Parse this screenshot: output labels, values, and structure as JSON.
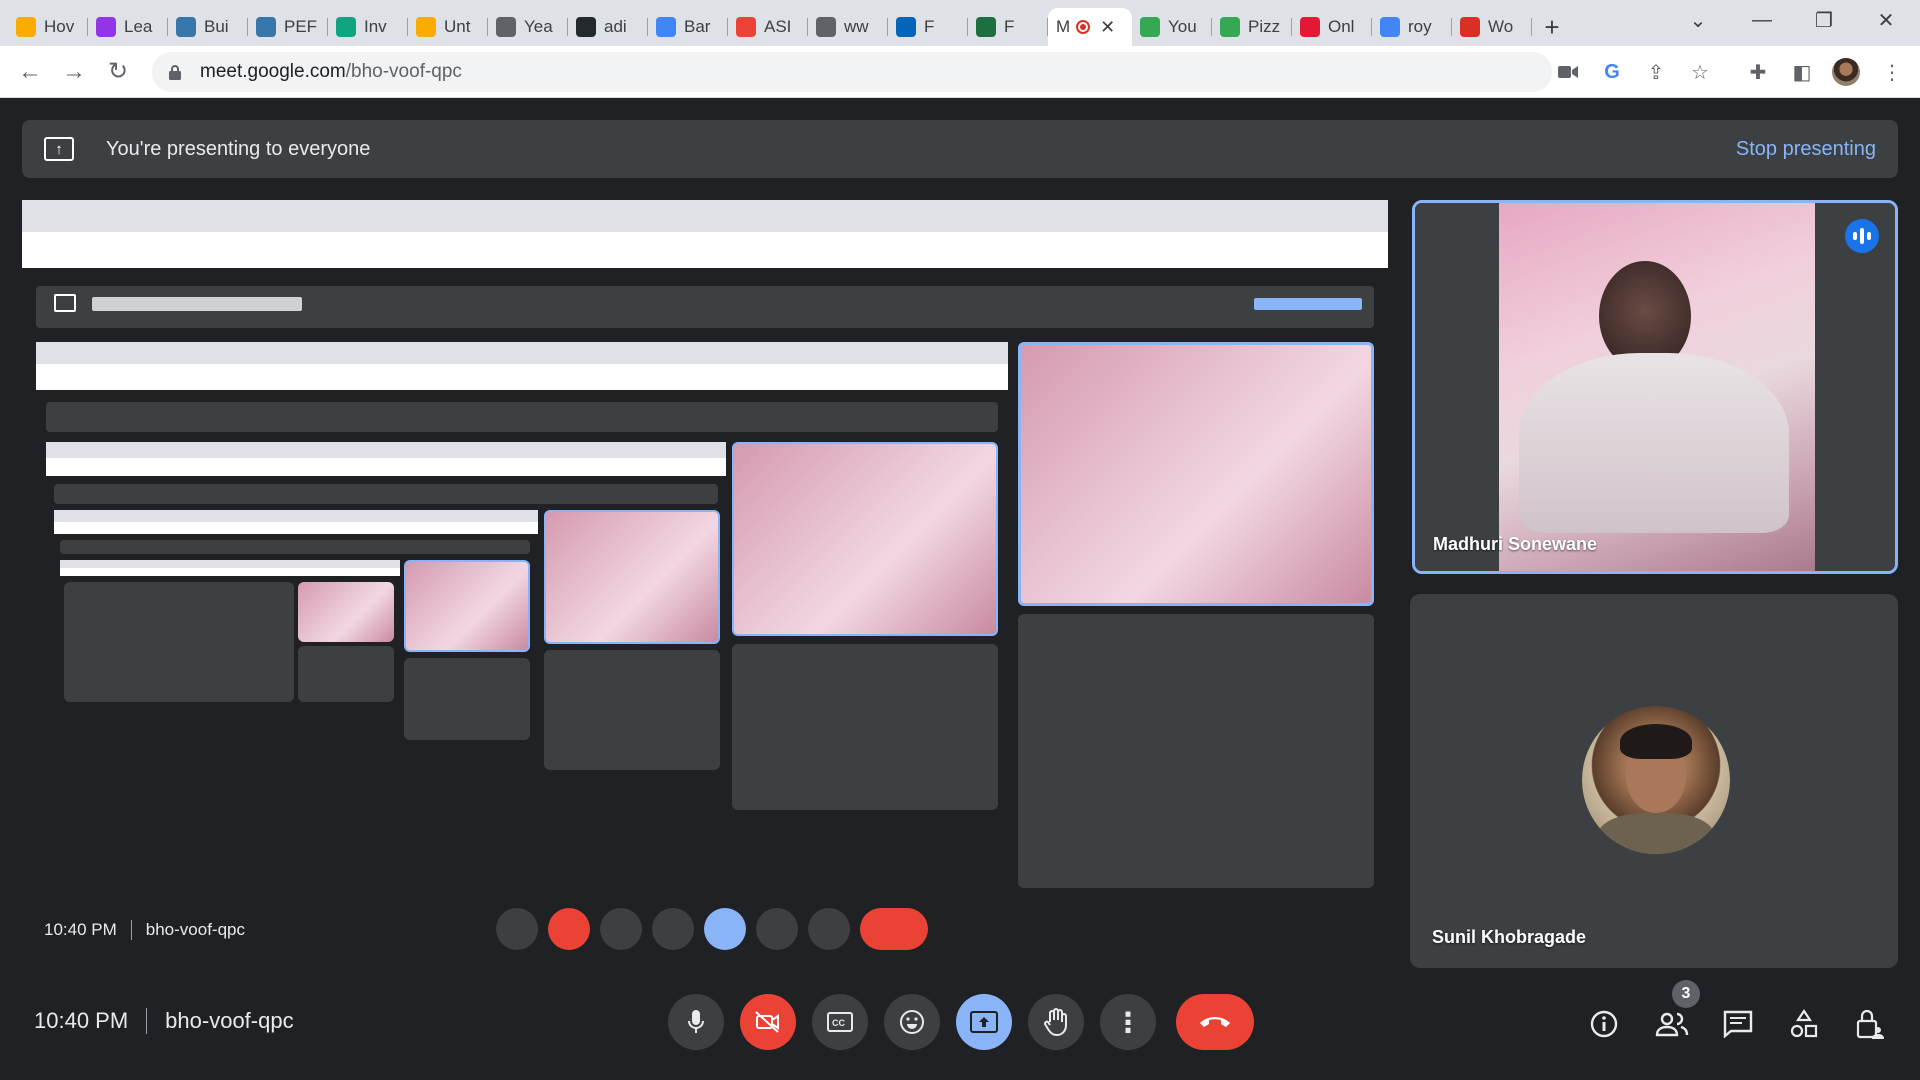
{
  "browser": {
    "tabs": [
      {
        "label": "Hov",
        "icon": "folder-icon",
        "color": "#f9ab00"
      },
      {
        "label": "Lea",
        "icon": "learn-icon",
        "color": "#9334e6"
      },
      {
        "label": "Bui",
        "icon": "python-icon",
        "color": "#3776ab"
      },
      {
        "label": "PEF",
        "icon": "python-icon",
        "color": "#3776ab"
      },
      {
        "label": "Inv",
        "icon": "openai-icon",
        "color": "#10a37f"
      },
      {
        "label": "Unt",
        "icon": "colab-icon",
        "color": "#f9ab00"
      },
      {
        "label": "Yea",
        "icon": "globe-icon",
        "color": "#5f6368"
      },
      {
        "label": "adi",
        "icon": "github-icon",
        "color": "#24292e"
      },
      {
        "label": "Bar",
        "icon": "bard-icon",
        "color": "#4285f4"
      },
      {
        "label": "ASI",
        "icon": "arrow-icon",
        "color": "#ea4335"
      },
      {
        "label": "ww",
        "icon": "globe-icon",
        "color": "#5f6368"
      },
      {
        "label": "F",
        "icon": "onedrive-icon",
        "color": "#0364b8"
      },
      {
        "label": "F",
        "icon": "excel-icon",
        "color": "#1d6f42"
      },
      {
        "label": "M",
        "icon": "meet-recording-icon",
        "color": "#d93025",
        "active": true
      },
      {
        "label": "You",
        "icon": "maps-icon",
        "color": "#34a853"
      },
      {
        "label": "Pizz",
        "icon": "maps-icon",
        "color": "#34a853"
      },
      {
        "label": "Onl",
        "icon": "dominos-icon",
        "color": "#e31837"
      },
      {
        "label": "roy",
        "icon": "google-icon",
        "color": "#4285f4"
      },
      {
        "label": "Wo",
        "icon": "wordmark-icon",
        "color": "#d93025"
      }
    ],
    "newtab_label": "+",
    "url_host": "meet.google.com",
    "url_path": "/bho-voof-qpc"
  },
  "meet": {
    "presenting_message": "You're presenting to everyone",
    "stop_presenting_label": "Stop presenting",
    "time": "10:40 PM",
    "meeting_code": "bho-voof-qpc",
    "participant_count": "3",
    "accent": "#8ab4f8",
    "end_call_color": "#ea4335",
    "participants": [
      {
        "name": "Madhuri Sonewane",
        "speaking": true
      },
      {
        "name": "Sunil Khobragade",
        "speaking": false
      }
    ]
  }
}
